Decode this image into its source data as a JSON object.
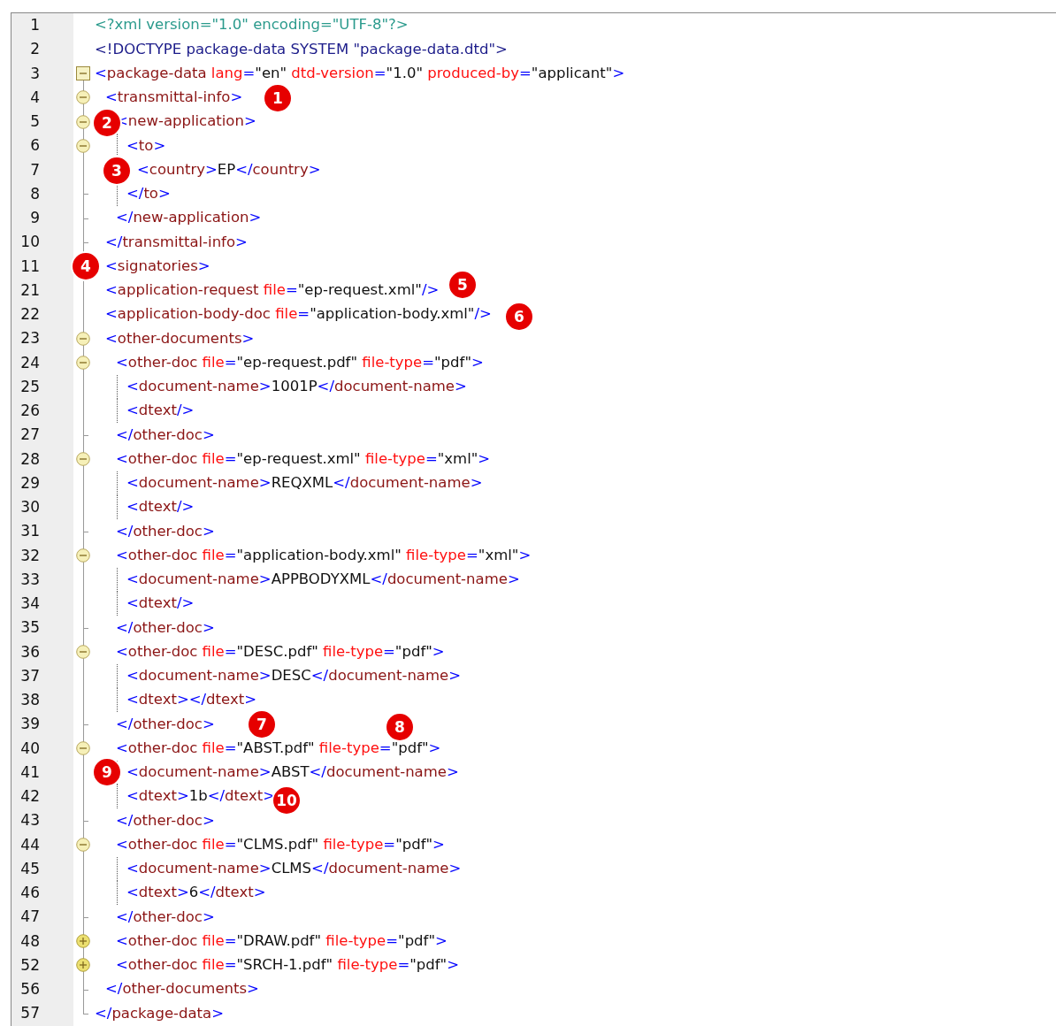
{
  "lines": [
    {
      "number": "1",
      "tokens": [
        {
          "kind": "decl",
          "text": "<?xml version=\"1.0\" encoding=\"UTF-8\"?>"
        }
      ]
    },
    {
      "number": "2",
      "tokens": [
        {
          "kind": "doctype",
          "text": "<!DOCTYPE package-data SYSTEM \"package-data.dtd\">"
        }
      ]
    },
    {
      "number": "3",
      "expanded": true,
      "tokens": [
        {
          "kind": "p",
          "text": "<"
        },
        {
          "kind": "tag",
          "text": "package-data"
        },
        {
          "kind": "attr",
          "text": " lang"
        },
        {
          "kind": "p",
          "text": "="
        },
        {
          "kind": "val",
          "text": "\"en\""
        },
        {
          "kind": "attr",
          "text": " dtd-version"
        },
        {
          "kind": "p",
          "text": "="
        },
        {
          "kind": "val",
          "text": "\"1.0\""
        },
        {
          "kind": "attr",
          "text": " produced-by"
        },
        {
          "kind": "p",
          "text": "="
        },
        {
          "kind": "val",
          "text": "\"applicant\""
        },
        {
          "kind": "p",
          "text": ">"
        }
      ],
      "end": {
        "number": "57",
        "tokens": [
          {
            "kind": "p",
            "text": "</"
          },
          {
            "kind": "tag",
            "text": "package-data"
          },
          {
            "kind": "p",
            "text": ">"
          }
        ]
      },
      "children": [
        {
          "number": "4",
          "expanded": true,
          "badges": [
            "1"
          ],
          "tokens": [
            {
              "kind": "p",
              "text": "<"
            },
            {
              "kind": "tag",
              "text": "transmittal-info"
            },
            {
              "kind": "p",
              "text": ">"
            }
          ],
          "end": {
            "number": "10",
            "tokens": [
              {
                "kind": "p",
                "text": "</"
              },
              {
                "kind": "tag",
                "text": "transmittal-info"
              },
              {
                "kind": "p",
                "text": ">"
              }
            ]
          },
          "children": [
            {
              "number": "5",
              "expanded": true,
              "badges": [
                "2"
              ],
              "tokens": [
                {
                  "kind": "p",
                  "text": "<"
                },
                {
                  "kind": "tag",
                  "text": "new-application"
                },
                {
                  "kind": "p",
                  "text": ">"
                }
              ],
              "end": {
                "number": "9",
                "tokens": [
                  {
                    "kind": "p",
                    "text": "</"
                  },
                  {
                    "kind": "tag",
                    "text": "new-application"
                  },
                  {
                    "kind": "p",
                    "text": ">"
                  }
                ]
              },
              "children": [
                {
                  "number": "6",
                  "expanded": true,
                  "tokens": [
                    {
                      "kind": "p",
                      "text": "<"
                    },
                    {
                      "kind": "tag",
                      "text": "to"
                    },
                    {
                      "kind": "p",
                      "text": ">"
                    }
                  ],
                  "end": {
                    "number": "8",
                    "tokens": [
                      {
                        "kind": "p",
                        "text": "</"
                      },
                      {
                        "kind": "tag",
                        "text": "to"
                      },
                      {
                        "kind": "p",
                        "text": ">"
                      }
                    ]
                  },
                  "children": [
                    {
                      "number": "7",
                      "badges": [
                        "3"
                      ],
                      "tokens": [
                        {
                          "kind": "p",
                          "text": "<"
                        },
                        {
                          "kind": "tag",
                          "text": "country"
                        },
                        {
                          "kind": "p",
                          "text": ">"
                        },
                        {
                          "kind": "text",
                          "text": "EP"
                        },
                        {
                          "kind": "p",
                          "text": "</"
                        },
                        {
                          "kind": "tag",
                          "text": "country"
                        },
                        {
                          "kind": "p",
                          "text": ">"
                        }
                      ]
                    }
                  ]
                }
              ]
            }
          ]
        },
        {
          "number": "11",
          "badges": [
            "4"
          ],
          "tokens": [
            {
              "kind": "p",
              "text": "<"
            },
            {
              "kind": "tag",
              "text": "signatories"
            },
            {
              "kind": "p",
              "text": ">"
            }
          ]
        },
        {
          "number": "21",
          "badges": [
            "5"
          ],
          "tokens": [
            {
              "kind": "p",
              "text": "<"
            },
            {
              "kind": "tag",
              "text": "application-request"
            },
            {
              "kind": "attr",
              "text": " file"
            },
            {
              "kind": "p",
              "text": "="
            },
            {
              "kind": "val",
              "text": "\"ep-request.xml\""
            },
            {
              "kind": "p",
              "text": "/>"
            }
          ]
        },
        {
          "number": "22",
          "badges": [
            "6"
          ],
          "tokens": [
            {
              "kind": "p",
              "text": "<"
            },
            {
              "kind": "tag",
              "text": "application-body-doc"
            },
            {
              "kind": "attr",
              "text": " file"
            },
            {
              "kind": "p",
              "text": "="
            },
            {
              "kind": "val",
              "text": "\"application-body.xml\""
            },
            {
              "kind": "p",
              "text": "/>"
            }
          ]
        },
        {
          "number": "23",
          "expanded": true,
          "tokens": [
            {
              "kind": "p",
              "text": "<"
            },
            {
              "kind": "tag",
              "text": "other-documents"
            },
            {
              "kind": "p",
              "text": ">"
            }
          ],
          "end": {
            "number": "56",
            "tokens": [
              {
                "kind": "p",
                "text": "</"
              },
              {
                "kind": "tag",
                "text": "other-documents"
              },
              {
                "kind": "p",
                "text": ">"
              }
            ]
          },
          "children": [
            {
              "number": "24",
              "expanded": true,
              "tokens": [
                {
                  "kind": "p",
                  "text": "<"
                },
                {
                  "kind": "tag",
                  "text": "other-doc"
                },
                {
                  "kind": "attr",
                  "text": " file"
                },
                {
                  "kind": "p",
                  "text": "="
                },
                {
                  "kind": "val",
                  "text": "\"ep-request.pdf\""
                },
                {
                  "kind": "attr",
                  "text": " file-type"
                },
                {
                  "kind": "p",
                  "text": "="
                },
                {
                  "kind": "val",
                  "text": "\"pdf\""
                },
                {
                  "kind": "p",
                  "text": ">"
                }
              ],
              "end": {
                "number": "27",
                "tokens": [
                  {
                    "kind": "p",
                    "text": "</"
                  },
                  {
                    "kind": "tag",
                    "text": "other-doc"
                  },
                  {
                    "kind": "p",
                    "text": ">"
                  }
                ]
              },
              "children": [
                {
                  "number": "25",
                  "tokens": [
                    {
                      "kind": "p",
                      "text": "<"
                    },
                    {
                      "kind": "tag",
                      "text": "document-name"
                    },
                    {
                      "kind": "p",
                      "text": ">"
                    },
                    {
                      "kind": "text",
                      "text": "1001P"
                    },
                    {
                      "kind": "p",
                      "text": "</"
                    },
                    {
                      "kind": "tag",
                      "text": "document-name"
                    },
                    {
                      "kind": "p",
                      "text": ">"
                    }
                  ]
                },
                {
                  "number": "26",
                  "tokens": [
                    {
                      "kind": "p",
                      "text": "<"
                    },
                    {
                      "kind": "tag",
                      "text": "dtext"
                    },
                    {
                      "kind": "p",
                      "text": "/>"
                    }
                  ]
                }
              ]
            },
            {
              "number": "28",
              "expanded": true,
              "tokens": [
                {
                  "kind": "p",
                  "text": "<"
                },
                {
                  "kind": "tag",
                  "text": "other-doc"
                },
                {
                  "kind": "attr",
                  "text": " file"
                },
                {
                  "kind": "p",
                  "text": "="
                },
                {
                  "kind": "val",
                  "text": "\"ep-request.xml\""
                },
                {
                  "kind": "attr",
                  "text": " file-type"
                },
                {
                  "kind": "p",
                  "text": "="
                },
                {
                  "kind": "val",
                  "text": "\"xml\""
                },
                {
                  "kind": "p",
                  "text": ">"
                }
              ],
              "end": {
                "number": "31",
                "tokens": [
                  {
                    "kind": "p",
                    "text": "</"
                  },
                  {
                    "kind": "tag",
                    "text": "other-doc"
                  },
                  {
                    "kind": "p",
                    "text": ">"
                  }
                ]
              },
              "children": [
                {
                  "number": "29",
                  "tokens": [
                    {
                      "kind": "p",
                      "text": "<"
                    },
                    {
                      "kind": "tag",
                      "text": "document-name"
                    },
                    {
                      "kind": "p",
                      "text": ">"
                    },
                    {
                      "kind": "text",
                      "text": "REQXML"
                    },
                    {
                      "kind": "p",
                      "text": "</"
                    },
                    {
                      "kind": "tag",
                      "text": "document-name"
                    },
                    {
                      "kind": "p",
                      "text": ">"
                    }
                  ]
                },
                {
                  "number": "30",
                  "tokens": [
                    {
                      "kind": "p",
                      "text": "<"
                    },
                    {
                      "kind": "tag",
                      "text": "dtext"
                    },
                    {
                      "kind": "p",
                      "text": "/>"
                    }
                  ]
                }
              ]
            },
            {
              "number": "32",
              "expanded": true,
              "tokens": [
                {
                  "kind": "p",
                  "text": "<"
                },
                {
                  "kind": "tag",
                  "text": "other-doc"
                },
                {
                  "kind": "attr",
                  "text": " file"
                },
                {
                  "kind": "p",
                  "text": "="
                },
                {
                  "kind": "val",
                  "text": "\"application-body.xml\""
                },
                {
                  "kind": "attr",
                  "text": " file-type"
                },
                {
                  "kind": "p",
                  "text": "="
                },
                {
                  "kind": "val",
                  "text": "\"xml\""
                },
                {
                  "kind": "p",
                  "text": ">"
                }
              ],
              "end": {
                "number": "35",
                "tokens": [
                  {
                    "kind": "p",
                    "text": "</"
                  },
                  {
                    "kind": "tag",
                    "text": "other-doc"
                  },
                  {
                    "kind": "p",
                    "text": ">"
                  }
                ]
              },
              "children": [
                {
                  "number": "33",
                  "tokens": [
                    {
                      "kind": "p",
                      "text": "<"
                    },
                    {
                      "kind": "tag",
                      "text": "document-name"
                    },
                    {
                      "kind": "p",
                      "text": ">"
                    },
                    {
                      "kind": "text",
                      "text": "APPBODYXML"
                    },
                    {
                      "kind": "p",
                      "text": "</"
                    },
                    {
                      "kind": "tag",
                      "text": "document-name"
                    },
                    {
                      "kind": "p",
                      "text": ">"
                    }
                  ]
                },
                {
                  "number": "34",
                  "tokens": [
                    {
                      "kind": "p",
                      "text": "<"
                    },
                    {
                      "kind": "tag",
                      "text": "dtext"
                    },
                    {
                      "kind": "p",
                      "text": "/>"
                    }
                  ]
                }
              ]
            },
            {
              "number": "36",
              "expanded": true,
              "tokens": [
                {
                  "kind": "p",
                  "text": "<"
                },
                {
                  "kind": "tag",
                  "text": "other-doc"
                },
                {
                  "kind": "attr",
                  "text": " file"
                },
                {
                  "kind": "p",
                  "text": "="
                },
                {
                  "kind": "val",
                  "text": "\"DESC.pdf\""
                },
                {
                  "kind": "attr",
                  "text": " file-type"
                },
                {
                  "kind": "p",
                  "text": "="
                },
                {
                  "kind": "val",
                  "text": "\"pdf\""
                },
                {
                  "kind": "p",
                  "text": ">"
                }
              ],
              "end": {
                "number": "39",
                "badges": [
                  "7",
                  "8"
                ],
                "tokens": [
                  {
                    "kind": "p",
                    "text": "</"
                  },
                  {
                    "kind": "tag",
                    "text": "other-doc"
                  },
                  {
                    "kind": "p",
                    "text": ">"
                  }
                ]
              },
              "children": [
                {
                  "number": "37",
                  "tokens": [
                    {
                      "kind": "p",
                      "text": "<"
                    },
                    {
                      "kind": "tag",
                      "text": "document-name"
                    },
                    {
                      "kind": "p",
                      "text": ">"
                    },
                    {
                      "kind": "text",
                      "text": "DESC"
                    },
                    {
                      "kind": "p",
                      "text": "</"
                    },
                    {
                      "kind": "tag",
                      "text": "document-name"
                    },
                    {
                      "kind": "p",
                      "text": ">"
                    }
                  ]
                },
                {
                  "number": "38",
                  "tokens": [
                    {
                      "kind": "p",
                      "text": "<"
                    },
                    {
                      "kind": "tag",
                      "text": "dtext"
                    },
                    {
                      "kind": "p",
                      "text": ">"
                    },
                    {
                      "kind": "p",
                      "text": "</"
                    },
                    {
                      "kind": "tag",
                      "text": "dtext"
                    },
                    {
                      "kind": "p",
                      "text": ">"
                    }
                  ]
                }
              ]
            },
            {
              "number": "40",
              "expanded": true,
              "tokens": [
                {
                  "kind": "p",
                  "text": "<"
                },
                {
                  "kind": "tag",
                  "text": "other-doc"
                },
                {
                  "kind": "attr",
                  "text": " file"
                },
                {
                  "kind": "p",
                  "text": "="
                },
                {
                  "kind": "val",
                  "text": "\"ABST.pdf\""
                },
                {
                  "kind": "attr",
                  "text": " file-type"
                },
                {
                  "kind": "p",
                  "text": "="
                },
                {
                  "kind": "val",
                  "text": "\"pdf\""
                },
                {
                  "kind": "p",
                  "text": ">"
                }
              ],
              "end": {
                "number": "43",
                "tokens": [
                  {
                    "kind": "p",
                    "text": "</"
                  },
                  {
                    "kind": "tag",
                    "text": "other-doc"
                  },
                  {
                    "kind": "p",
                    "text": ">"
                  }
                ]
              },
              "children": [
                {
                  "number": "41",
                  "badges": [
                    "9"
                  ],
                  "tokens": [
                    {
                      "kind": "p",
                      "text": "<"
                    },
                    {
                      "kind": "tag",
                      "text": "document-name"
                    },
                    {
                      "kind": "p",
                      "text": ">"
                    },
                    {
                      "kind": "text",
                      "text": "ABST"
                    },
                    {
                      "kind": "p",
                      "text": "</"
                    },
                    {
                      "kind": "tag",
                      "text": "document-name"
                    },
                    {
                      "kind": "p",
                      "text": ">"
                    }
                  ]
                },
                {
                  "number": "42",
                  "badges": [
                    "10"
                  ],
                  "tokens": [
                    {
                      "kind": "p",
                      "text": "<"
                    },
                    {
                      "kind": "tag",
                      "text": "dtext"
                    },
                    {
                      "kind": "p",
                      "text": ">"
                    },
                    {
                      "kind": "text",
                      "text": "1b"
                    },
                    {
                      "kind": "p",
                      "text": "</"
                    },
                    {
                      "kind": "tag",
                      "text": "dtext"
                    },
                    {
                      "kind": "p",
                      "text": ">"
                    }
                  ]
                }
              ]
            },
            {
              "number": "44",
              "expanded": true,
              "tokens": [
                {
                  "kind": "p",
                  "text": "<"
                },
                {
                  "kind": "tag",
                  "text": "other-doc"
                },
                {
                  "kind": "attr",
                  "text": " file"
                },
                {
                  "kind": "p",
                  "text": "="
                },
                {
                  "kind": "val",
                  "text": "\"CLMS.pdf\""
                },
                {
                  "kind": "attr",
                  "text": " file-type"
                },
                {
                  "kind": "p",
                  "text": "="
                },
                {
                  "kind": "val",
                  "text": "\"pdf\""
                },
                {
                  "kind": "p",
                  "text": ">"
                }
              ],
              "end": {
                "number": "47",
                "tokens": [
                  {
                    "kind": "p",
                    "text": "</"
                  },
                  {
                    "kind": "tag",
                    "text": "other-doc"
                  },
                  {
                    "kind": "p",
                    "text": ">"
                  }
                ]
              },
              "children": [
                {
                  "number": "45",
                  "tokens": [
                    {
                      "kind": "p",
                      "text": "<"
                    },
                    {
                      "kind": "tag",
                      "text": "document-name"
                    },
                    {
                      "kind": "p",
                      "text": ">"
                    },
                    {
                      "kind": "text",
                      "text": "CLMS"
                    },
                    {
                      "kind": "p",
                      "text": "</"
                    },
                    {
                      "kind": "tag",
                      "text": "document-name"
                    },
                    {
                      "kind": "p",
                      "text": ">"
                    }
                  ]
                },
                {
                  "number": "46",
                  "tokens": [
                    {
                      "kind": "p",
                      "text": "<"
                    },
                    {
                      "kind": "tag",
                      "text": "dtext"
                    },
                    {
                      "kind": "p",
                      "text": ">"
                    },
                    {
                      "kind": "text",
                      "text": "6"
                    },
                    {
                      "kind": "p",
                      "text": "</"
                    },
                    {
                      "kind": "tag",
                      "text": "dtext"
                    },
                    {
                      "kind": "p",
                      "text": ">"
                    }
                  ]
                }
              ]
            },
            {
              "number": "48",
              "expanded": false,
              "tokens": [
                {
                  "kind": "p",
                  "text": "<"
                },
                {
                  "kind": "tag",
                  "text": "other-doc"
                },
                {
                  "kind": "attr",
                  "text": " file"
                },
                {
                  "kind": "p",
                  "text": "="
                },
                {
                  "kind": "val",
                  "text": "\"DRAW.pdf\""
                },
                {
                  "kind": "attr",
                  "text": " file-type"
                },
                {
                  "kind": "p",
                  "text": "="
                },
                {
                  "kind": "val",
                  "text": "\"pdf\""
                },
                {
                  "kind": "p",
                  "text": ">"
                }
              ]
            },
            {
              "number": "52",
              "expanded": false,
              "tokens": [
                {
                  "kind": "p",
                  "text": "<"
                },
                {
                  "kind": "tag",
                  "text": "other-doc"
                },
                {
                  "kind": "attr",
                  "text": " file"
                },
                {
                  "kind": "p",
                  "text": "="
                },
                {
                  "kind": "val",
                  "text": "\"SRCH-1.pdf\""
                },
                {
                  "kind": "attr",
                  "text": " file-type"
                },
                {
                  "kind": "p",
                  "text": "="
                },
                {
                  "kind": "val",
                  "text": "\"pdf\""
                },
                {
                  "kind": "p",
                  "text": ">"
                }
              ]
            }
          ]
        }
      ]
    }
  ]
}
